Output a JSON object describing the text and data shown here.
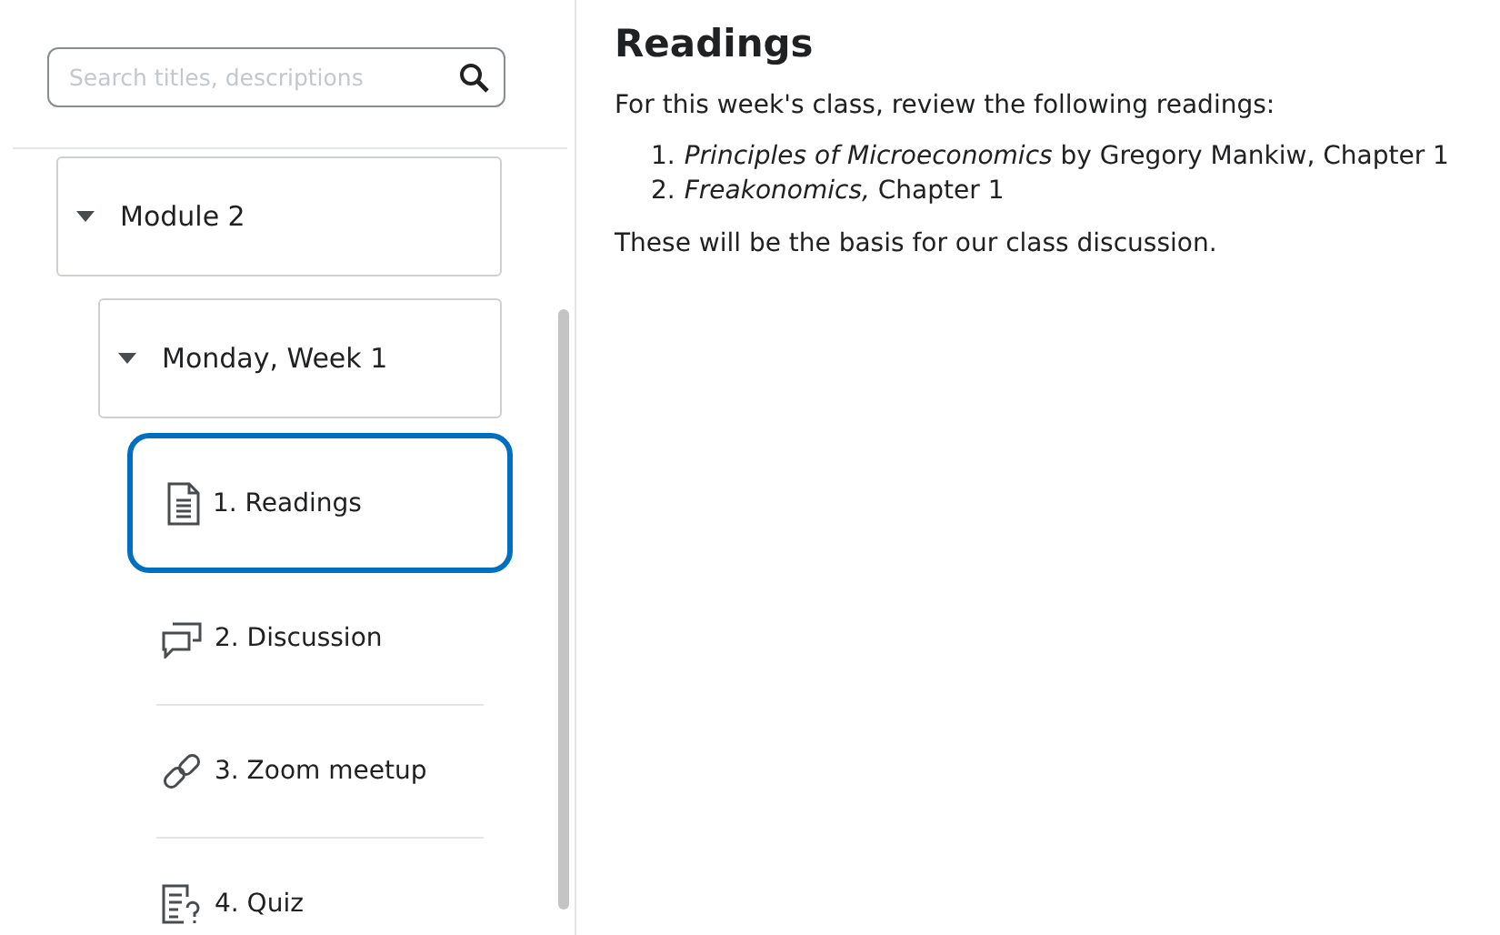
{
  "search": {
    "placeholder": "Search titles, descriptions"
  },
  "tree": [
    {
      "label": "Module 2",
      "expanded": true,
      "children": [
        {
          "label": "Monday, Week 1",
          "expanded": true,
          "children": [
            {
              "kind": "document",
              "label": "1. Readings",
              "selected": true
            },
            {
              "kind": "discussion",
              "label": "2. Discussion",
              "selected": false
            },
            {
              "kind": "link",
              "label": "3. Zoom meetup",
              "selected": false
            },
            {
              "kind": "quiz",
              "label": "4. Quiz",
              "selected": false
            }
          ]
        }
      ]
    }
  ],
  "content": {
    "title": "Readings",
    "intro": "For this week's class, review the following readings:",
    "readings": [
      {
        "number": "1.",
        "text": "*Principles of Microeconomics* by Gregory Mankiw, Chapter 1"
      },
      {
        "number": "2.",
        "text": "*Freakonomics,* Chapter 1"
      }
    ],
    "outro": "These will be the basis for our class discussion."
  }
}
